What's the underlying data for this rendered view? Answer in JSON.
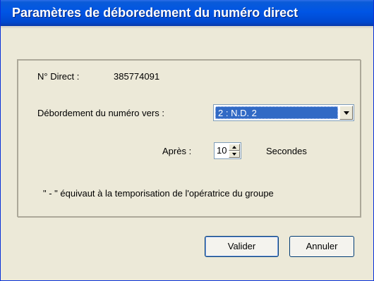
{
  "window": {
    "title": "Paramètres de déboredement du numéro direct"
  },
  "group": {
    "direct_label": "N° Direct :",
    "direct_value": "385774091",
    "overflow_label": "Débordement du numéro vers :",
    "overflow_selected": "2 : N.D. 2",
    "after_label": "Après :",
    "after_value": "10",
    "seconds_label": "Secondes",
    "note": "\" - \"  équivaut à la temporisation de l'opératrice du groupe"
  },
  "buttons": {
    "validate": "Valider",
    "cancel": "Annuler"
  },
  "colors": {
    "title_bar": "#0055e5",
    "selection": "#316ac5",
    "dialog_bg": "#ece9d8"
  }
}
